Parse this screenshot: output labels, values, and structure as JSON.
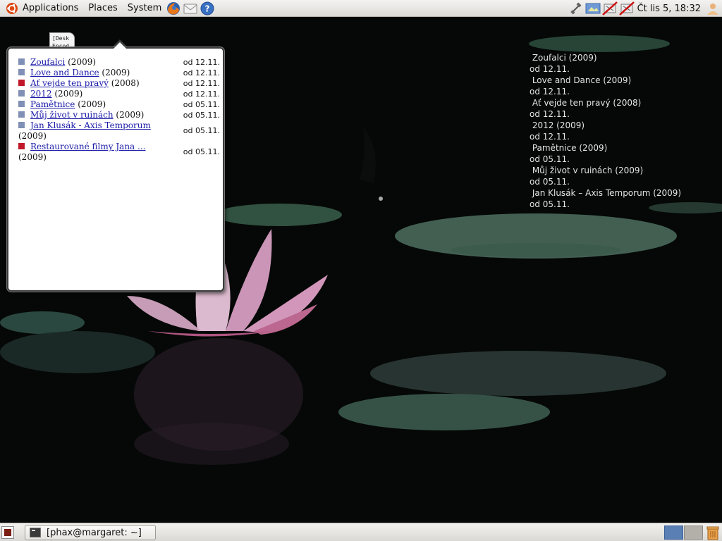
{
  "top_panel": {
    "menus": [
      "Applications",
      "Places",
      "System"
    ],
    "launchers": [
      "firefox-icon",
      "mail-icon",
      "help-icon"
    ],
    "clock": "Čt lis  5, 18:32",
    "tray_icons": [
      "network-icon",
      "display-icon",
      "disabled-applet-icon",
      "disabled-applet-icon",
      "user-icon"
    ]
  },
  "desktop_icon": {
    "label_line1": "[Desk",
    "label_line2": "Encod"
  },
  "popup": {
    "movies": [
      {
        "title": "Zoufalci",
        "year": "(2009)",
        "date": "od 12.11.",
        "marker_color": "#7f8fb5"
      },
      {
        "title": "Love and Dance",
        "year": "(2009)",
        "date": "od 12.11.",
        "marker_color": "#7f8fb5"
      },
      {
        "title": "Ať vejde ten pravý",
        "year": "(2008)",
        "date": "od 12.11.",
        "marker_color": "#c0182a"
      },
      {
        "title": "2012",
        "year": "(2009)",
        "date": "od 12.11.",
        "marker_color": "#7f8fb5"
      },
      {
        "title": "Pamětnice",
        "year": "(2009)",
        "date": "od 05.11.",
        "marker_color": "#7f8fb5"
      },
      {
        "title": "Můj život v ruinách",
        "year": "(2009)",
        "date": "od 05.11.",
        "marker_color": "#7f8fb5"
      },
      {
        "title": "Jan Klusák - Axis Temporum",
        "year": "(2009)",
        "date": "od 05.11.",
        "marker_color": "#7f8fb5"
      },
      {
        "title": "Restaurované filmy Jana ...",
        "year": "(2009)",
        "date": "od 05.11.",
        "marker_color": "#c0182a"
      }
    ]
  },
  "desktop_overlay": {
    "text": " Zoufalci (2009)\nod 12.11.\n Love and Dance (2009)\nod 12.11.\n Ať vejde ten pravý (2008)\nod 12.11.\n 2012 (2009)\nod 12.11.\n Pamětnice (2009)\nod 05.11.\n Můj život v ruinách (2009)\nod 05.11.\n Jan Klusák – Axis Temporum (2009)\nod 05.11."
  },
  "bottom_panel": {
    "task_label": "[phax@margaret: ~]",
    "workspace_colors": [
      "#5a7fb4",
      "#b3b0aa"
    ]
  }
}
